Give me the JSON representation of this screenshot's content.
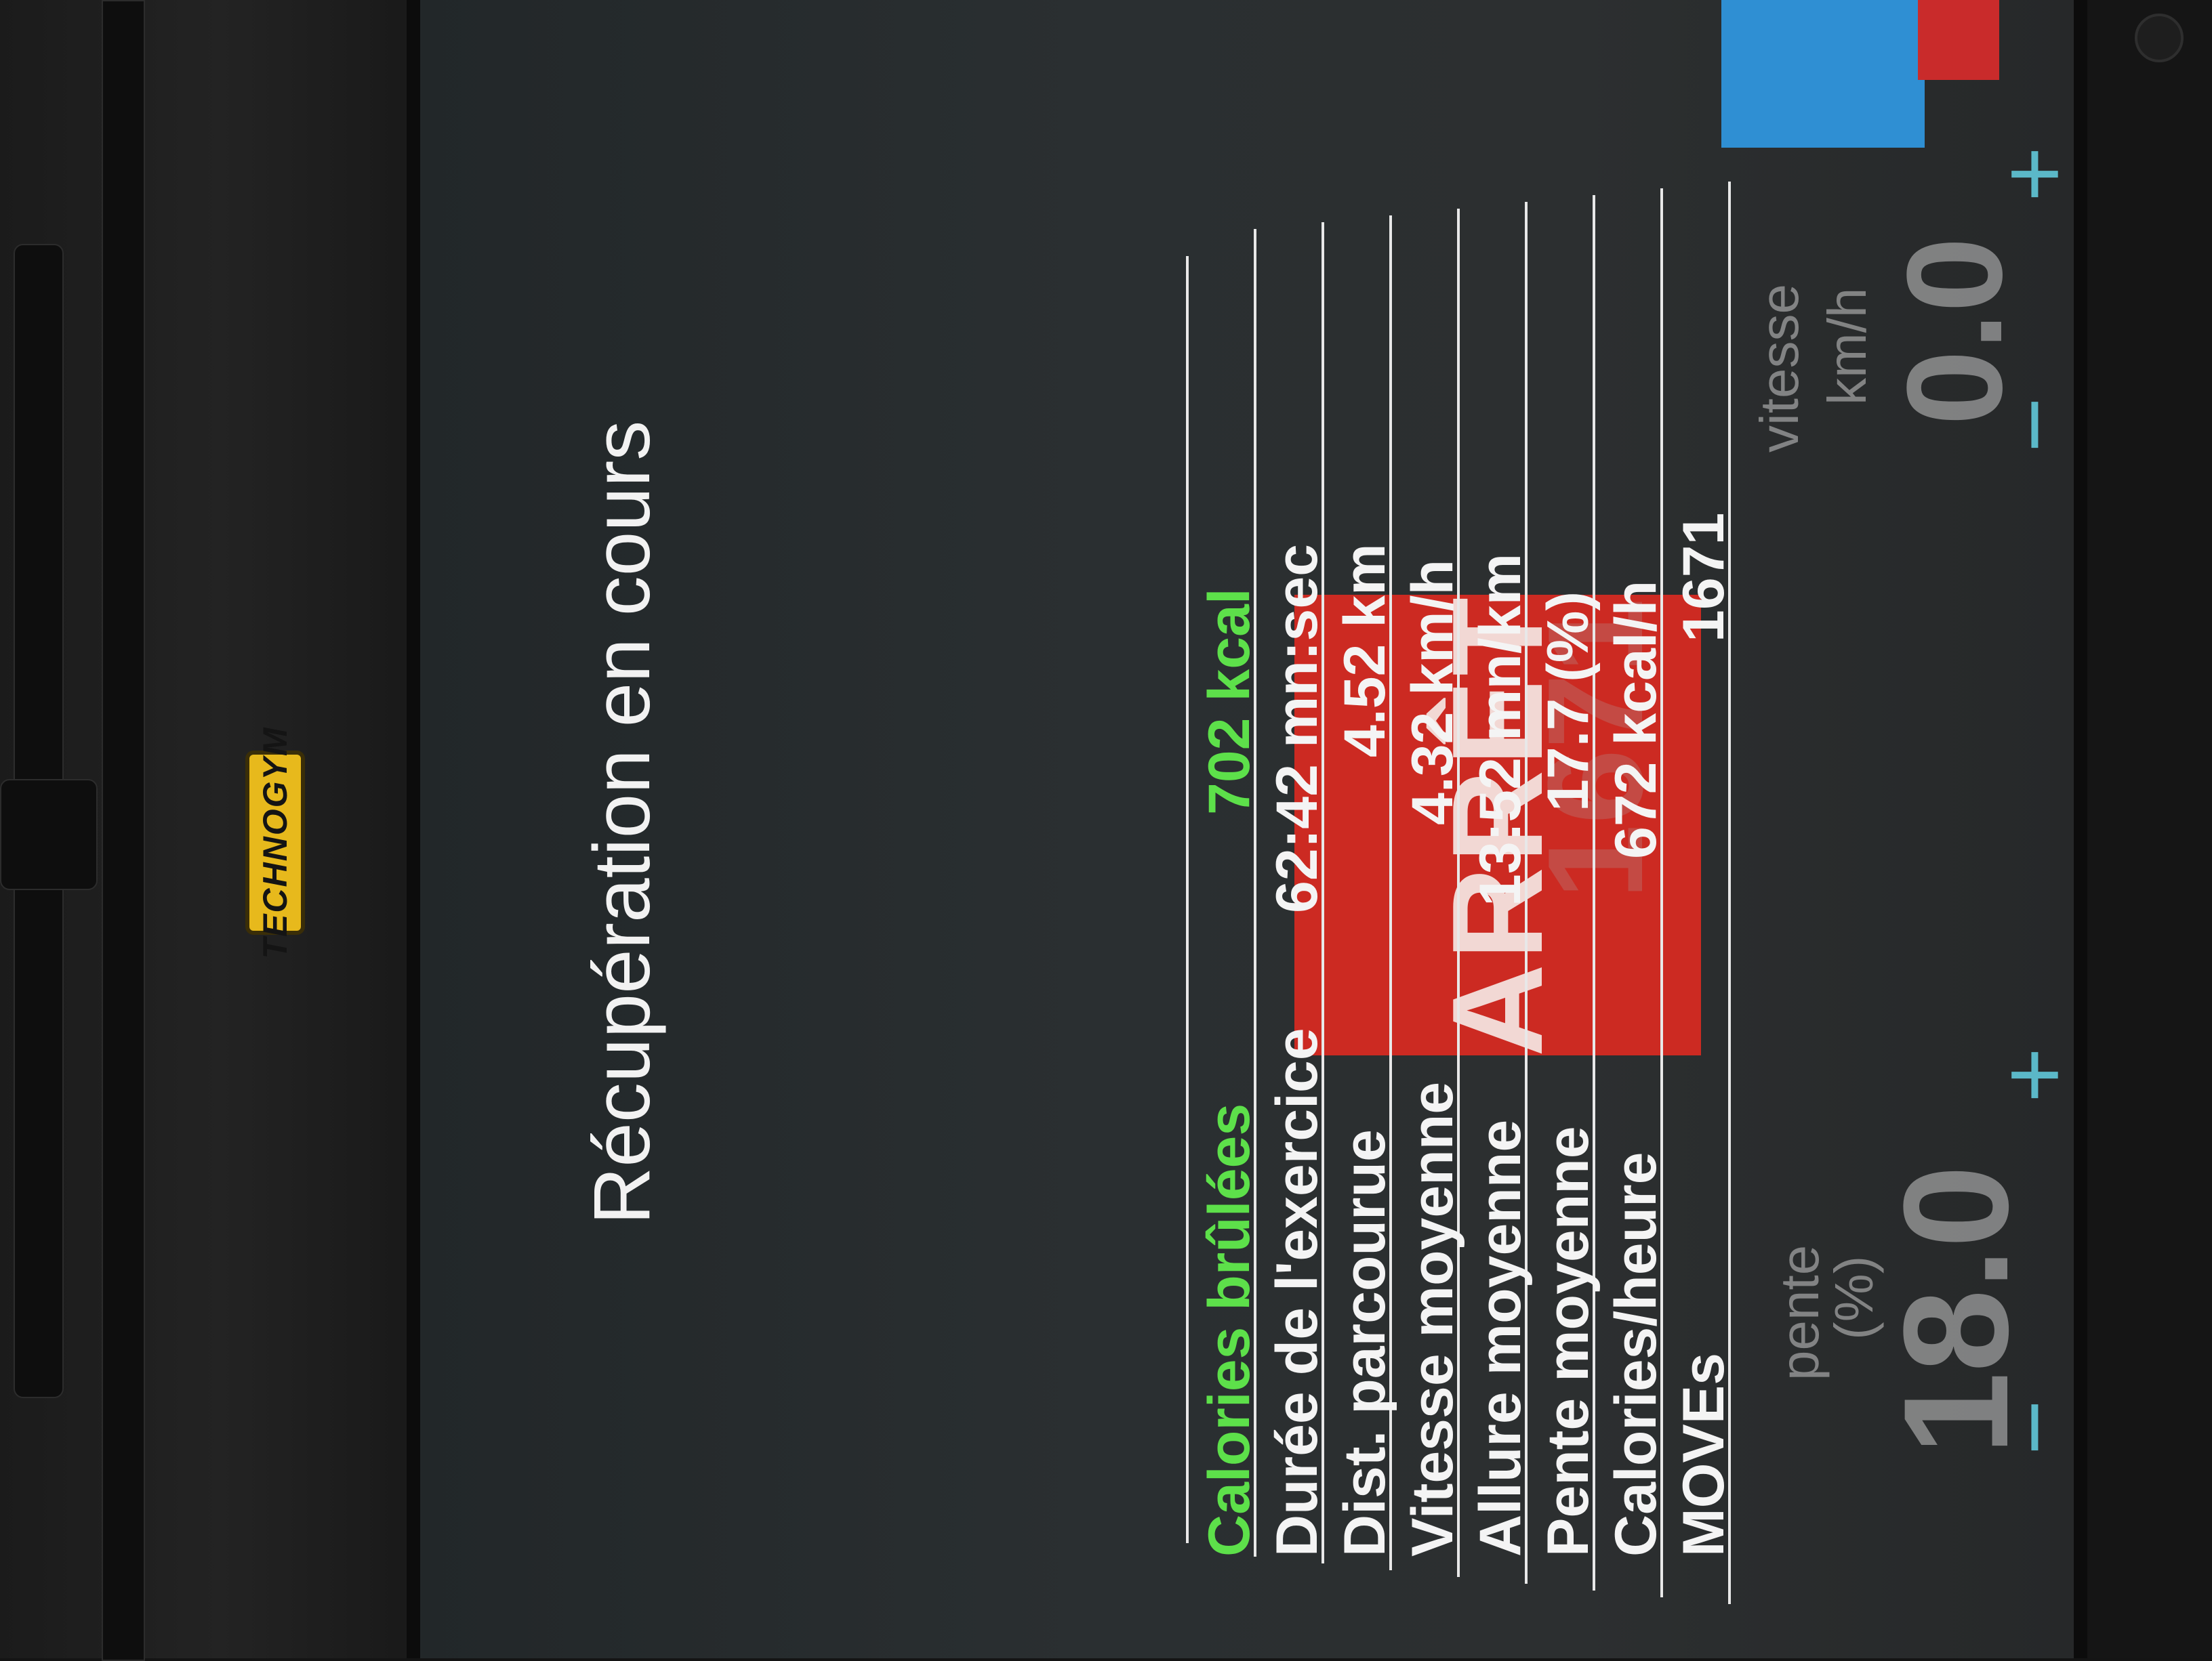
{
  "brand": {
    "logo_text": "TECHNOGYM"
  },
  "summary": {
    "title": "Récupération en cours",
    "rows": [
      {
        "label": "Calories brûlées",
        "value": "702 kcal",
        "highlight": true
      },
      {
        "label": "Durée de l'exercice",
        "value": "62:42 mn:sec"
      },
      {
        "label": "Dist. parcourue",
        "value": "4.52 km"
      },
      {
        "label": "Vitesse moyenne",
        "value": "4.32 km/h"
      },
      {
        "label": "Allure moyenne",
        "value": "13:52 mn/km"
      },
      {
        "label": "Pente moyenne",
        "value": "17.7 (%)"
      },
      {
        "label": "Calories/heure",
        "value": "672 kcal/h"
      },
      {
        "label": "MOVEs",
        "value": "1671"
      }
    ]
  },
  "background": {
    "incline": {
      "label": "pente",
      "unit": "(%)",
      "value": "18.0",
      "minus": "−",
      "plus": "+"
    },
    "speed": {
      "label": "vitesse",
      "unit": "km/h",
      "value": "0.0",
      "minus": "−",
      "plus": "+"
    },
    "stop_button": "ARRÊT",
    "moves_ghost": "1671"
  },
  "colors": {
    "highlight": "#5de04a",
    "stop": "#cc2a22",
    "logo": "#e7b91c"
  }
}
